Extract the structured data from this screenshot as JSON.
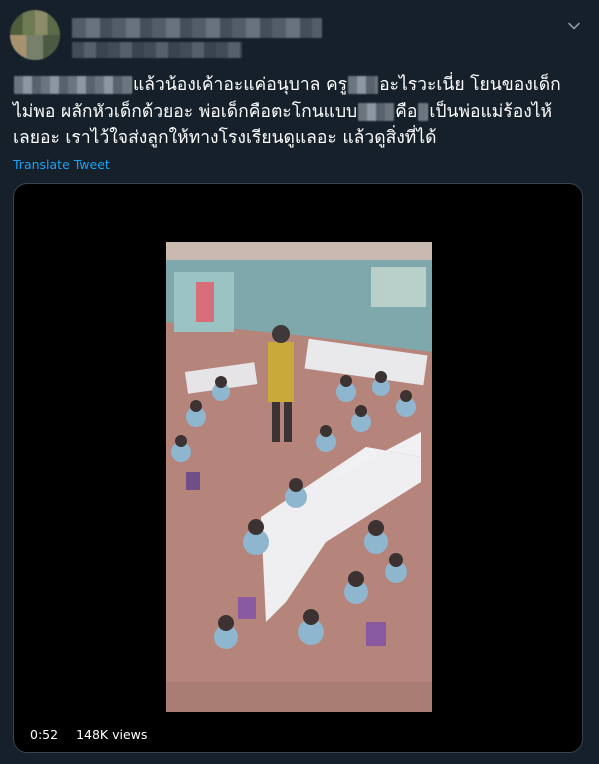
{
  "tweet": {
    "text_lines": [
      {
        "before": "",
        "redacted": true,
        "after": "แล้วน้องเค้าอะแค่อนุบาล ครู",
        "redact2": true,
        "after2": "อะไรวะเนี่ย โยนของเด็ก"
      },
      {
        "text": "ไม่พอ ผลักหัวเด็กด้วยอะ พ่อเด็กคือตะโกนแบบ",
        "redact": true,
        "after": "คือ",
        "redact2": true,
        "after2": "เป็นพ่อแม่ร้องไห้"
      },
      {
        "text": "เลยอะ เราไว้ใจส่งลูกให้ทางโรงเรียนดูแลอะ แล้วดูสิ่งที่ได้"
      }
    ],
    "translate_label": "Translate Tweet"
  },
  "video": {
    "duration": "0:52",
    "views": "148K views"
  },
  "icons": {
    "menu": "chevron-down-icon"
  },
  "colors": {
    "background": "#15202b",
    "link": "#1da1f2",
    "border": "#38444d"
  }
}
